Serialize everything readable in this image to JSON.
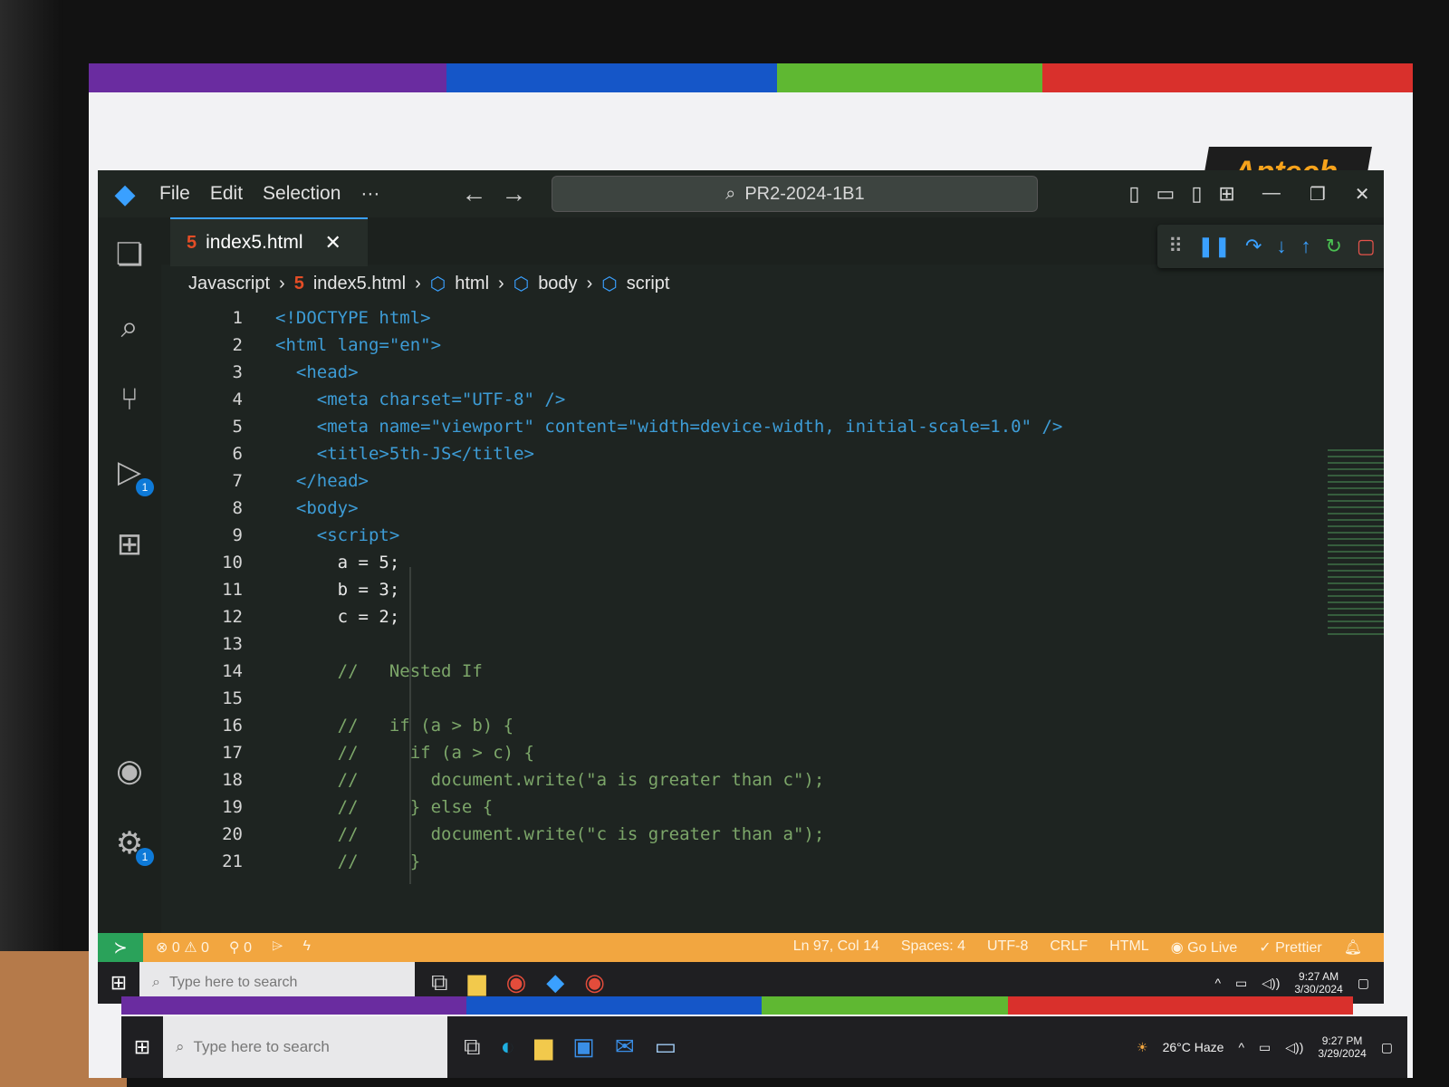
{
  "app": {
    "logo_text": "Aptech"
  },
  "menu": {
    "file": "File",
    "edit": "Edit",
    "selection": "Selection",
    "more": "···"
  },
  "command_center": {
    "text": "PR2-2024-1B1"
  },
  "tab": {
    "label": "index5.html"
  },
  "breadcrumb": {
    "root": "Javascript",
    "file": "index5.html",
    "html": "html",
    "body": "body",
    "script": "script"
  },
  "badges": {
    "run_debug": "1",
    "settings": "1"
  },
  "code_lines": [
    {
      "n": "1",
      "text": "<!DOCTYPE html>"
    },
    {
      "n": "2",
      "text": "<html lang=\"en\">"
    },
    {
      "n": "3",
      "text": "  <head>"
    },
    {
      "n": "4",
      "text": "    <meta charset=\"UTF-8\" />"
    },
    {
      "n": "5",
      "text": "    <meta name=\"viewport\" content=\"width=device-width, initial-scale=1.0\" />"
    },
    {
      "n": "6",
      "text": "    <title>5th-JS</title>"
    },
    {
      "n": "7",
      "text": "  </head>"
    },
    {
      "n": "8",
      "text": "  <body>"
    },
    {
      "n": "9",
      "text": "    <script>"
    },
    {
      "n": "10",
      "text": "      a = 5;"
    },
    {
      "n": "11",
      "text": "      b = 3;"
    },
    {
      "n": "12",
      "text": "      c = 2;"
    },
    {
      "n": "13",
      "text": ""
    },
    {
      "n": "14",
      "text": "      //   Nested If"
    },
    {
      "n": "15",
      "text": ""
    },
    {
      "n": "16",
      "text": "      //   if (a > b) {"
    },
    {
      "n": "17",
      "text": "      //     if (a > c) {"
    },
    {
      "n": "18",
      "text": "      //       document.write(\"a is greater than c\");"
    },
    {
      "n": "19",
      "text": "      //     } else {"
    },
    {
      "n": "20",
      "text": "      //       document.write(\"c is greater than a\");"
    },
    {
      "n": "21",
      "text": "      //     }"
    }
  ],
  "status": {
    "errors": "0",
    "warnings": "0",
    "ports": "0",
    "position": "Ln 97, Col 14",
    "spaces": "Spaces: 4",
    "encoding": "UTF-8",
    "eol": "CRLF",
    "language": "HTML",
    "golive": "Go Live",
    "prettier": "Prettier"
  },
  "taskbar": {
    "search_placeholder": "Type here to search",
    "time": "9:27 AM",
    "date": "3/30/2024"
  },
  "taskbar2": {
    "search_placeholder": "Type here to search",
    "weather": "26°C Haze",
    "time": "9:27 PM",
    "date": "3/29/2024"
  },
  "colors": {
    "stripe1": "#6a2ca0",
    "stripe2": "#1556c8",
    "stripe3": "#5fb832",
    "stripe4": "#d9302c",
    "status_bar": "#f2a640",
    "accent": "#3aa0ff"
  }
}
